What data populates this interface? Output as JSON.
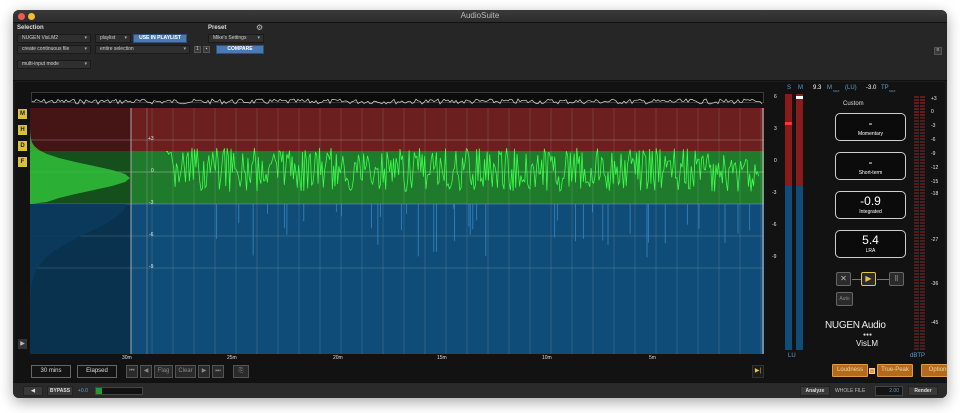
{
  "window": {
    "title": "AudioSuite"
  },
  "header": {
    "selection_label": "Selection",
    "preset_label": "Preset",
    "plugin_select": "NUGEN VisLM2",
    "playlist_select": "playlist",
    "use_in_playlist": "USE IN PLAYLIST",
    "preset_select": "Mike's Settings",
    "file_mode_select": "create continuous file",
    "selection_mode_select": "entire selection",
    "compare_label": "COMPARE",
    "preset_number": "1",
    "input_mode_select": "multi-input mode"
  },
  "graph": {
    "left_ticks": [
      "+3",
      "0",
      "-3",
      "-6",
      "-9"
    ],
    "time_labels": [
      "30m",
      "25m",
      "20m",
      "15m",
      "10m",
      "5m"
    ],
    "side_buttons": [
      "M",
      "H",
      "D",
      "F"
    ]
  },
  "transport": {
    "duration": "30 mins",
    "elapsed": "Elapsed",
    "flag": "Flag",
    "clear": "Clear"
  },
  "meters": {
    "s_label": "S",
    "m_label": "M",
    "lu_label": "LU",
    "dbtp_label": "dBTP",
    "lu_scale": [
      "6",
      "3",
      "0",
      "-3",
      "-6",
      "-9"
    ],
    "tp_scale": [
      "+3",
      "0",
      "-3",
      "-6",
      "-9",
      "-12",
      "-15",
      "-18",
      "-27",
      "-36",
      "-45"
    ],
    "m_max_value": "9.3",
    "m_max_label": "M",
    "m_max_sub": "MAX",
    "unit_label": "(LU)",
    "tp_max_value": "-3.0",
    "tp_max_label": "TP",
    "tp_max_sub": "MAX"
  },
  "readouts": {
    "preset_name": "Custom",
    "momentary_value": "-",
    "momentary_label": "Momentary",
    "shortterm_value": "-",
    "shortterm_label": "Short-term",
    "integrated_value": "-0.9",
    "integrated_label": "Integrated",
    "lra_value": "5.4",
    "lra_label": "LRA"
  },
  "controls": {
    "auto": "Auto",
    "brand": "NUGEN Audio",
    "product": "VisLM",
    "loudness_btn": "Loudness",
    "truepeak_btn": "True-Peak",
    "options_btn": "Options"
  },
  "bottom_bar": {
    "bypass": "BYPASS",
    "gain": "+0.0",
    "analyze": "Analyze",
    "whole_file": "WHOLE FILE",
    "handle_value": "2.00",
    "render": "Render"
  },
  "colors": {
    "green": "#1f9c2f",
    "blue": "#0f4d78",
    "red": "#6b1f1f",
    "accent_orange": "#b36a1c",
    "accent_blue": "#4b79b5"
  }
}
